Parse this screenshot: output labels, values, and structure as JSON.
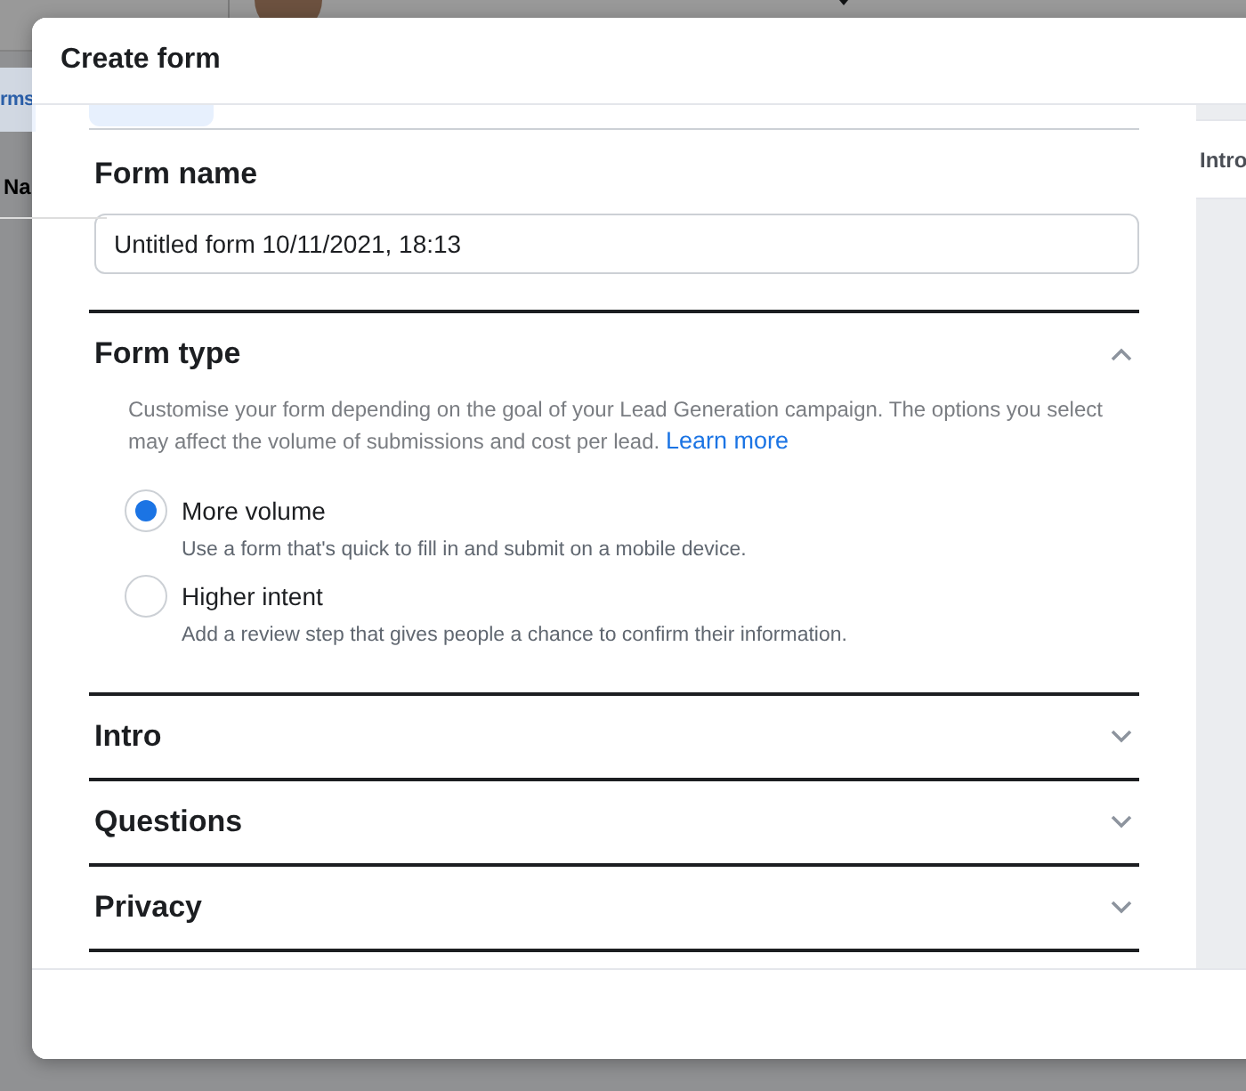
{
  "background_page": {
    "sidebar_item": "rms",
    "column_header": "Na"
  },
  "dialog": {
    "title": "Create form",
    "tabs": [
      {
        "selected": true
      }
    ],
    "form_name": {
      "label": "Form name",
      "value": "Untitled form 10/11/2021, 18:13"
    },
    "form_type": {
      "title": "Form type",
      "expanded": true,
      "description": "Customise your form depending on the goal of your Lead Generation campaign. The options you select may affect the volume of submissions and cost per lead.",
      "link": "Learn more",
      "options": [
        {
          "label": "More volume",
          "hint": "Use a form that's quick to fill in and submit on a mobile device.",
          "selected": true
        },
        {
          "label": "Higher intent",
          "hint": "Add a review step that gives people a chance to confirm their information.",
          "selected": false
        }
      ]
    },
    "sections": [
      {
        "title": "Intro",
        "expanded": false
      },
      {
        "title": "Questions",
        "expanded": false
      },
      {
        "title": "Privacy",
        "expanded": false
      }
    ],
    "preview_tab": "Intro"
  }
}
